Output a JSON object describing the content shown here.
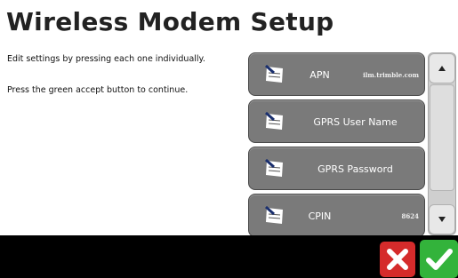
{
  "title": "Wireless Modem Setup",
  "instructions": {
    "line1": "Edit settings by pressing each one individually.",
    "line2": "Press the green accept button to continue."
  },
  "settings": [
    {
      "label": "APN",
      "value": "ilm.trimble.com",
      "icon": "edit-note-icon"
    },
    {
      "label": "GPRS User Name",
      "value": "",
      "icon": "edit-note-icon"
    },
    {
      "label": "GPRS Password",
      "value": "",
      "icon": "edit-note-icon"
    },
    {
      "label": "CPIN",
      "value": "8624",
      "icon": "edit-note-icon"
    }
  ],
  "scrollbar": {
    "up_icon": "arrow-up-icon",
    "down_icon": "arrow-down-icon"
  },
  "actions": {
    "cancel_icon": "x-icon",
    "accept_icon": "checkmark-icon"
  },
  "colors": {
    "button_gray": "#7a7a7a",
    "cancel_red": "#d52b2b",
    "accept_green": "#33b33b"
  }
}
